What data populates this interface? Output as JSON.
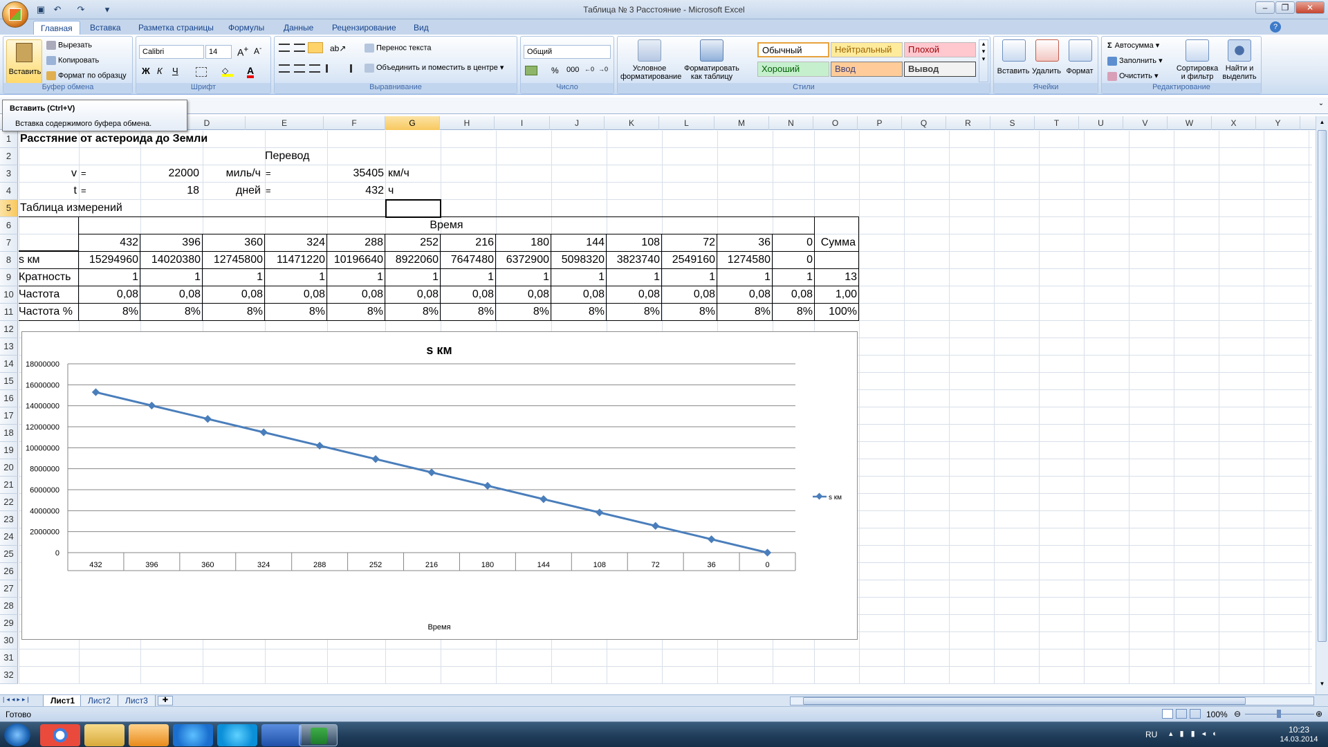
{
  "window": {
    "title": "Таблица № 3 Расстояние - Microsoft Excel"
  },
  "tabs": [
    "Главная",
    "Вставка",
    "Разметка страницы",
    "Формулы",
    "Данные",
    "Рецензирование",
    "Вид"
  ],
  "ribbon": {
    "clipboard": {
      "paste": "Вставить",
      "cut": "Вырезать",
      "copy": "Копировать",
      "format_painter": "Формат по образцу",
      "label": "Буфер обмена"
    },
    "font": {
      "name": "Calibri",
      "size": "14",
      "label": "Шрифт",
      "bold": "Ж",
      "italic": "К",
      "underline": "Ч"
    },
    "alignment": {
      "wrap": "Перенос текста",
      "merge": "Объединить и поместить в центре",
      "label": "Выравнивание"
    },
    "number": {
      "format": "Общий",
      "percent": "%",
      "thousands": "000",
      "label": "Число"
    },
    "styles": {
      "cond_format_1": "Условное",
      "cond_format_2": "форматирование",
      "fmt_table_1": "Форматировать",
      "fmt_table_2": "как таблицу",
      "normal": "Обычный",
      "neutral": "Нейтральный",
      "bad": "Плохой",
      "good": "Хороший",
      "input": "Ввод",
      "output": "Вывод",
      "label": "Стили"
    },
    "cells": {
      "insert": "Вставить",
      "delete": "Удалить",
      "format": "Формат",
      "label": "Ячейки"
    },
    "editing": {
      "autosum": "Автосумма",
      "fill": "Заполнить",
      "clear": "Очистить",
      "sort_1": "Сортировка",
      "sort_2": "и фильтр",
      "find_1": "Найти и",
      "find_2": "выделить",
      "label": "Редактирование"
    }
  },
  "tooltip": {
    "title": "Вставить (Ctrl+V)",
    "body": "Вставка содержимого буфера обмена."
  },
  "columns": [
    "D",
    "E",
    "F",
    "G",
    "H",
    "I",
    "J",
    "K",
    "L",
    "M",
    "N",
    "O",
    "P",
    "Q",
    "R",
    "S",
    "T",
    "U",
    "V",
    "W",
    "X",
    "Y"
  ],
  "rows": [
    "1",
    "2",
    "3",
    "4",
    "5",
    "6",
    "7",
    "8",
    "9",
    "10",
    "11",
    "12",
    "13",
    "14",
    "15",
    "16",
    "17",
    "18",
    "19",
    "20",
    "21",
    "22",
    "23",
    "24",
    "25",
    "26",
    "27",
    "28",
    "29",
    "30",
    "31",
    "32"
  ],
  "sheet": {
    "a1": "Расстяние от астероида до Земли",
    "e2": "Перевод",
    "a3": "v",
    "b3": "=",
    "c3": "22000",
    "d3": "миль/ч",
    "e3": "=",
    "f3": "35405",
    "g3": "км/ч",
    "a4": "t",
    "b4": "=",
    "c4": "18",
    "d4": "дней",
    "e4": "=",
    "f4": "432",
    "g4": "ч",
    "a5": "Таблица измерений",
    "time_header": "Время",
    "row8_label": "s км",
    "row9_label": "Кратность",
    "row10_label": "Частота",
    "row11_label": "Частота %",
    "sum_label": "Сумма",
    "times": [
      "432",
      "396",
      "360",
      "324",
      "288",
      "252",
      "216",
      "180",
      "144",
      "108",
      "72",
      "36",
      "0"
    ],
    "distances": [
      "15294960",
      "14020380",
      "12745800",
      "11471220",
      "10196640",
      "8922060",
      "7647480",
      "6372900",
      "5098320",
      "3823740",
      "2549160",
      "1274580",
      "0"
    ],
    "multiplicity": [
      "1",
      "1",
      "1",
      "1",
      "1",
      "1",
      "1",
      "1",
      "1",
      "1",
      "1",
      "1",
      "1"
    ],
    "frequency": [
      "0,08",
      "0,08",
      "0,08",
      "0,08",
      "0,08",
      "0,08",
      "0,08",
      "0,08",
      "0,08",
      "0,08",
      "0,08",
      "0,08",
      "0,08"
    ],
    "frequency_pct": [
      "8%",
      "8%",
      "8%",
      "8%",
      "8%",
      "8%",
      "8%",
      "8%",
      "8%",
      "8%",
      "8%",
      "8%",
      "8%"
    ],
    "sum_multiplicity": "13",
    "sum_frequency": "1,00",
    "sum_frequency_pct": "100%"
  },
  "chart_data": {
    "type": "line",
    "title": "s км",
    "xlabel": "Время",
    "ylabel": "",
    "categories": [
      "432",
      "396",
      "360",
      "324",
      "288",
      "252",
      "216",
      "180",
      "144",
      "108",
      "72",
      "36",
      "0"
    ],
    "series": [
      {
        "name": "s км",
        "values": [
          15294960,
          14020380,
          12745800,
          11471220,
          10196640,
          8922060,
          7647480,
          6372900,
          5098320,
          3823740,
          2549160,
          1274580,
          0
        ],
        "color": "#4a7ebb"
      }
    ],
    "ylim": [
      0,
      18000000
    ],
    "yticks": [
      "0",
      "2000000",
      "4000000",
      "6000000",
      "8000000",
      "10000000",
      "12000000",
      "14000000",
      "16000000",
      "18000000"
    ],
    "grid": true,
    "legend": "right"
  },
  "sheet_tabs": [
    "Лист1",
    "Лист2",
    "Лист3"
  ],
  "status": {
    "ready": "Готово",
    "zoom": "100%"
  },
  "taskbar": {
    "lang": "RU",
    "time": "10:23",
    "date": "14.03.2014"
  },
  "colors": {
    "accent": "#15428b",
    "series": "#4a7ebb",
    "good": "#c6efce",
    "neutral": "#ffeb9c",
    "bad": "#ffc7ce",
    "input": "#ffcc99"
  }
}
